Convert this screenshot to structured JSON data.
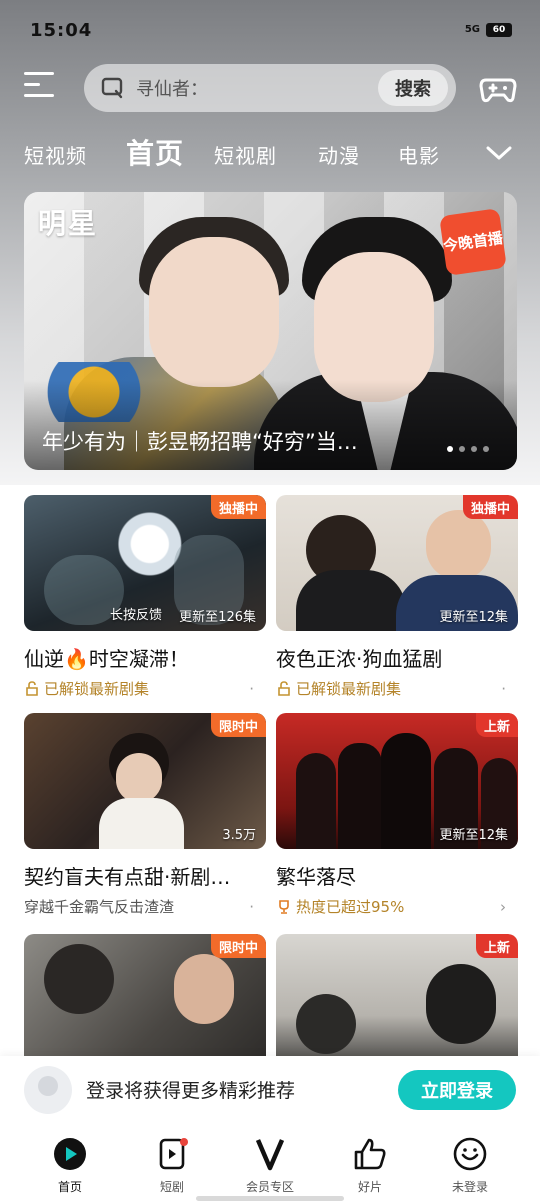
{
  "status_bar": {
    "time": "15:04",
    "network": "5G",
    "battery": "60"
  },
  "search": {
    "placeholder": "寻仙者：",
    "button_label": "搜索"
  },
  "tabs": [
    {
      "label": "短视频"
    },
    {
      "label": "首页",
      "active": true
    },
    {
      "label": "短视剧"
    },
    {
      "label": "动漫"
    },
    {
      "label": "电影"
    }
  ],
  "banner": {
    "logo": "明星",
    "badge": "今晚首播",
    "title": "年少有为｜彭昱畅招聘“好穷”当…",
    "dots_count": 4
  },
  "cards": [
    {
      "title": "仙逆🔥时空凝滞！",
      "badge": "独播中",
      "caption": "更新至126集",
      "caption_left": "长按反馈",
      "sub": "已解锁最新剧集",
      "sub_style": "hot"
    },
    {
      "title": "夜色正浓·狗血猛剧",
      "badge": "独播中",
      "caption": "更新至12集",
      "caption_left": "",
      "sub": "已解锁最新剧集",
      "sub_style": "hot"
    },
    {
      "title": "契约盲夫有点甜·新剧…",
      "badge": "限时中",
      "caption": "3.5万",
      "caption_left": "",
      "sub": "穿越千金霸气反击渣渣",
      "sub_style": "plain"
    },
    {
      "title": "繁华落尽",
      "badge": "上新",
      "caption": "更新至12集",
      "caption_left": "",
      "sub": "热度已超过95%",
      "sub_style": "hot"
    },
    {
      "title": "",
      "badge": "限时中",
      "caption": "",
      "caption_left": "",
      "sub": "",
      "sub_style": "plain"
    },
    {
      "title": "",
      "badge": "上新",
      "caption": "",
      "caption_left": "",
      "sub": "",
      "sub_style": "plain"
    }
  ],
  "login_bar": {
    "text": "登录将获得更多精彩推荐",
    "button": "立即登录"
  },
  "bottom_nav": [
    {
      "label": "首页",
      "icon": "play-icon",
      "active": true
    },
    {
      "label": "短剧",
      "icon": "short-drama-icon"
    },
    {
      "label": "会员专区",
      "icon": "vip-v-icon"
    },
    {
      "label": "好片",
      "icon": "thumbs-up-icon"
    },
    {
      "label": "未登录",
      "icon": "smile-icon"
    }
  ],
  "colors": {
    "accent": "#14c7c0",
    "badge_orange": "#f26b2a",
    "badge_red": "#e2372c"
  }
}
